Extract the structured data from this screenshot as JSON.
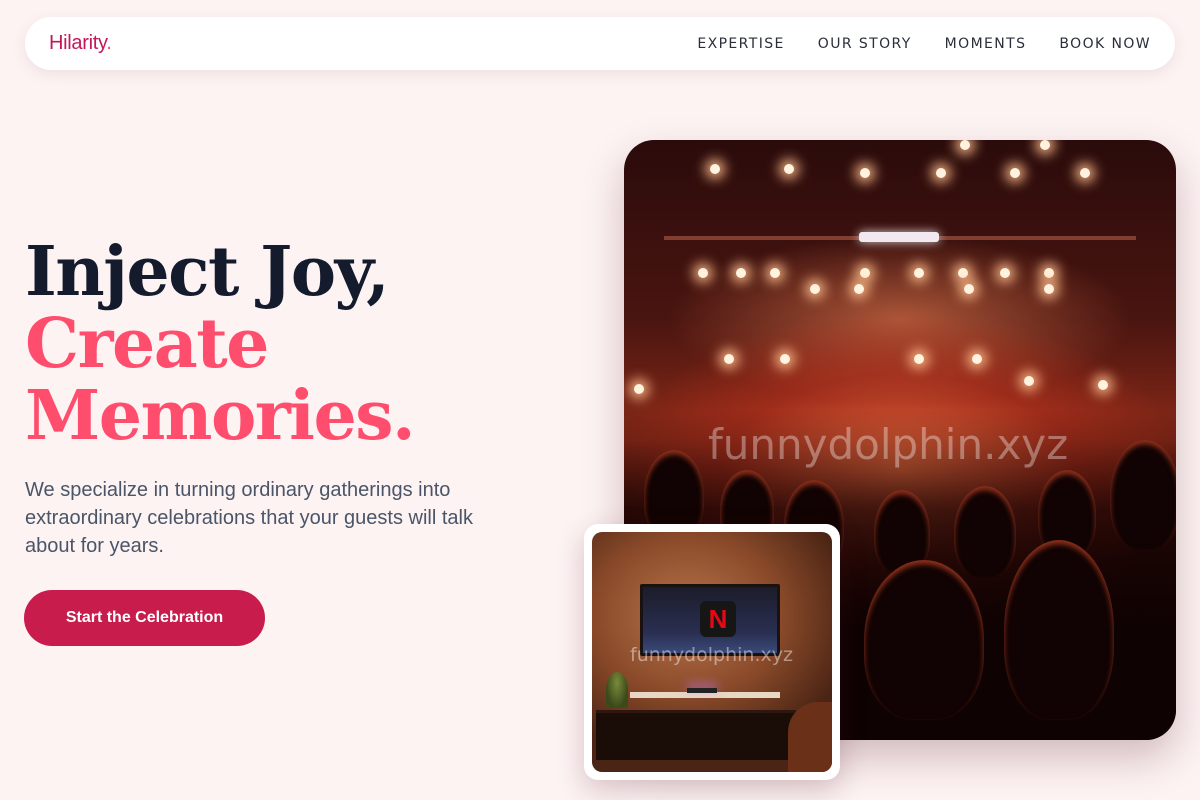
{
  "brand": {
    "name": "Hilarity",
    "dot": "."
  },
  "nav": {
    "items": [
      {
        "label": "EXPERTISE"
      },
      {
        "label": "OUR STORY"
      },
      {
        "label": "MOMENTS"
      },
      {
        "label": "BOOK NOW"
      }
    ]
  },
  "hero": {
    "title_line1": "Inject Joy,",
    "title_line2": "Create",
    "title_line3": "Memories.",
    "description": "We specialize in turning ordinary gatherings into extraordinary celebrations that your guests will talk about for years.",
    "cta_label": "Start the Celebration"
  },
  "media": {
    "watermark": "funnydolphin.xyz",
    "tv_logo": "N"
  },
  "colors": {
    "accent": "#ff4d6d",
    "cta": "#c81c4d",
    "brand": "#c2185b",
    "heading": "#141b2d",
    "background": "#fdf3f3"
  }
}
